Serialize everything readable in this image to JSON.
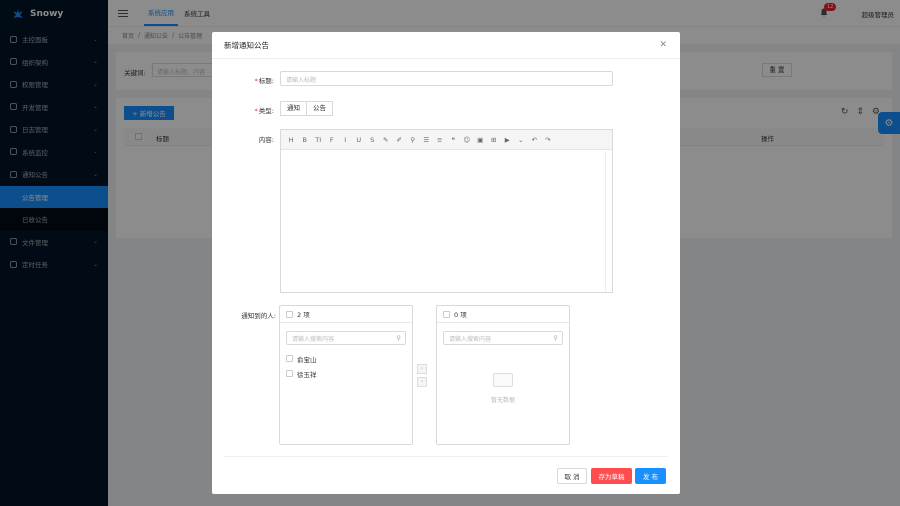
{
  "app": {
    "name": "Snowy"
  },
  "sidebar": {
    "items": [
      {
        "label": "主控面板",
        "icon": "dashboard-icon"
      },
      {
        "label": "组织架构",
        "icon": "org-icon"
      },
      {
        "label": "权限管理",
        "icon": "shield-icon"
      },
      {
        "label": "开发管理",
        "icon": "dev-icon"
      },
      {
        "label": "日志管理",
        "icon": "log-icon"
      },
      {
        "label": "系统监控",
        "icon": "monitor-icon"
      },
      {
        "label": "通知公告",
        "icon": "notice-icon"
      }
    ],
    "submenu": [
      {
        "label": "公告管理"
      },
      {
        "label": "已收公告"
      }
    ],
    "after": [
      {
        "label": "文件管理",
        "icon": "file-icon"
      },
      {
        "label": "定时任务",
        "icon": "timer-icon"
      }
    ]
  },
  "header": {
    "tabs": [
      "系统应用",
      "系统工具"
    ],
    "notify_count": "12",
    "user": "超级管理员"
  },
  "breadcrumb": [
    "首页",
    "/",
    "通知公告",
    "/",
    "公告管理"
  ],
  "search": {
    "keyword_label": "关键词:",
    "placeholder": "请输入标题、内容",
    "reset": "重 置"
  },
  "table": {
    "add_label": "+ 新增公告",
    "col_title": "标题",
    "col_ops": "操作"
  },
  "modal": {
    "title": "新增通知公告",
    "title_label": "标题:",
    "title_placeholder": "请输入标题",
    "type_label": "类型:",
    "type_options": [
      "通知",
      "公告"
    ],
    "content_label": "内容:",
    "toolbar_glyphs": [
      "H",
      "B",
      "TI",
      "F",
      "I",
      "U",
      "S",
      "✎",
      "✐",
      "⚲",
      "☰",
      "≡",
      "❝",
      "☺",
      "▣",
      "⊞",
      "▶",
      "⌄",
      "↶",
      "↷"
    ],
    "transfer_label": "通知到的人:",
    "left_count": "2 项",
    "right_count": "0 项",
    "search_placeholder": "请输入搜索内容",
    "left_items": [
      "俞宝山",
      "徐玉祥"
    ],
    "empty_text": "暂无数据",
    "buttons": {
      "cancel": "取 消",
      "draft": "存为草稿",
      "publish": "发 布"
    }
  },
  "colors": {
    "primary": "#1890ff",
    "danger": "#ff4d4f",
    "sidebar": "#001529"
  }
}
